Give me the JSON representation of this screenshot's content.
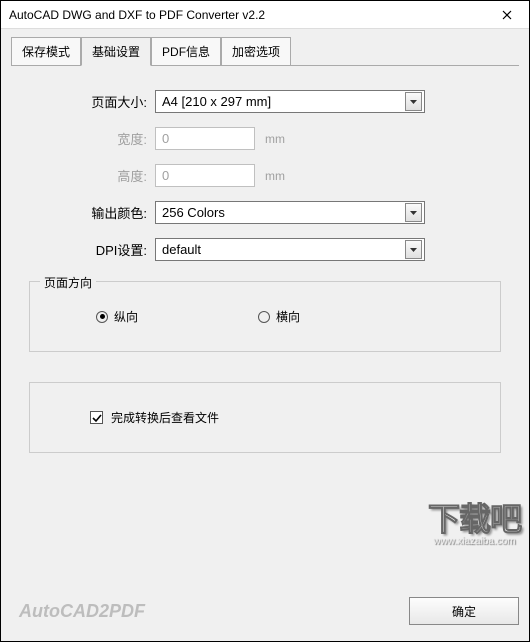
{
  "title": "AutoCAD DWG and DXF to PDF Converter v2.2",
  "tabs": {
    "save_mode": "保存模式",
    "basic_settings": "基础设置",
    "pdf_info": "PDF信息",
    "encrypt_options": "加密选项"
  },
  "labels": {
    "page_size": "页面大小:",
    "width": "宽度:",
    "height": "高度:",
    "output_color": "输出颜色:",
    "dpi_setting": "DPI设置:"
  },
  "values": {
    "page_size": "A4 [210 x 297 mm]",
    "width": "0",
    "height": "0",
    "output_color": "256 Colors",
    "dpi_setting": "default"
  },
  "units": {
    "mm": "mm"
  },
  "orientation": {
    "legend": "页面方向",
    "portrait": "纵向",
    "landscape": "横向"
  },
  "checkbox": {
    "open_after": "完成转换后查看文件"
  },
  "brand": "AutoCAD2PDF",
  "button_ok": "确定",
  "watermark": {
    "main": "下载吧",
    "sub": "www.xiazaiba.com"
  }
}
